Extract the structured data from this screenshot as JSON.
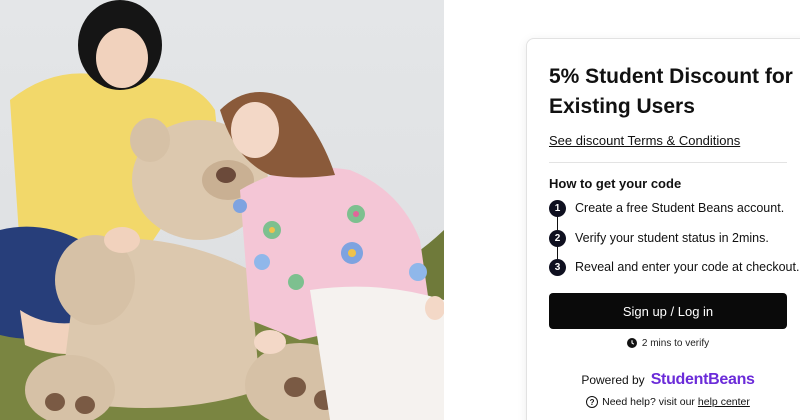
{
  "offer": {
    "title": "5% Student Discount for Existing Users",
    "terms_link": "See discount Terms & Conditions"
  },
  "how_to": {
    "heading": "How to get your code",
    "steps": [
      {
        "num": "1",
        "text": "Create a free Student Beans account."
      },
      {
        "num": "2",
        "text": "Verify your student status in 2mins."
      },
      {
        "num": "3",
        "text": "Reveal and enter your code at checkout."
      }
    ]
  },
  "cta": {
    "signup_label": "Sign up / Log in",
    "verify_note": "2 mins to verify"
  },
  "footer": {
    "powered_by": "Powered by",
    "brand": "StudentBeans",
    "help_prefix": "Need help? visit our",
    "help_link": "help center"
  },
  "colors": {
    "button_bg": "#0a0a0a",
    "brand_purple": "#6b2bd9",
    "step_badge": "#0f1020"
  },
  "icons": {
    "clock": "clock-icon",
    "help": "question-circle-icon"
  }
}
